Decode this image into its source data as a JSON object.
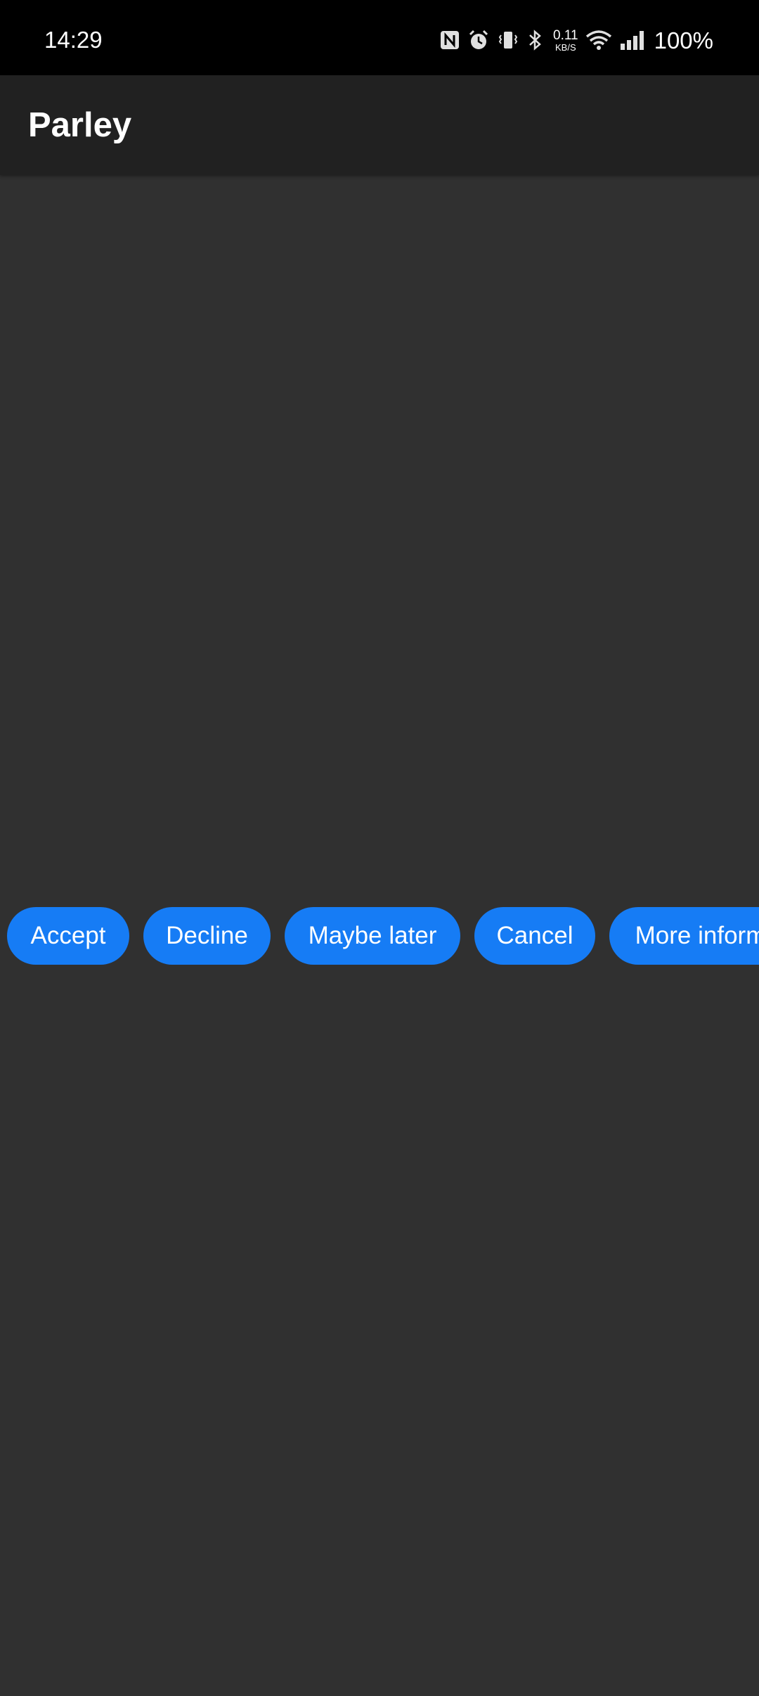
{
  "status_bar": {
    "time": "14:29",
    "net_speed_value": "0.11",
    "net_speed_unit": "KB/S",
    "battery": "100%",
    "icons": [
      "nfc-icon",
      "alarm-icon",
      "vibrate-icon",
      "bluetooth-icon",
      "wifi-icon",
      "signal-icon"
    ]
  },
  "app_bar": {
    "title": "Parley"
  },
  "chips": [
    {
      "label": "Accept"
    },
    {
      "label": "Decline"
    },
    {
      "label": "Maybe later"
    },
    {
      "label": "Cancel"
    },
    {
      "label": "More inform"
    }
  ],
  "colors": {
    "status_bar_bg": "#000000",
    "app_bar_bg": "#212121",
    "screen_bg": "#303030",
    "chip_bg": "#167cf5",
    "text": "#ffffff"
  }
}
